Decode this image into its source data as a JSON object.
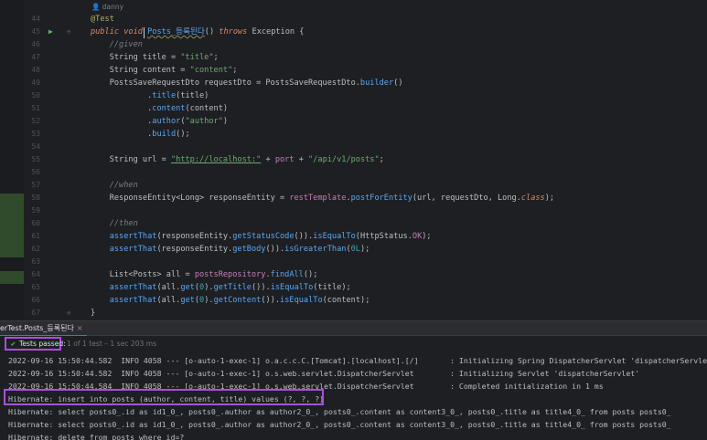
{
  "editor": {
    "author_hint": "👤 danny",
    "lines": [
      {
        "n": "44",
        "segs": [
          {
            "t": "@Test",
            "c": "ann"
          }
        ]
      },
      {
        "n": "45",
        "segs": [
          {
            "t": "public ",
            "c": "kw"
          },
          {
            "t": "void ",
            "c": "kw"
          },
          {
            "t": "Posts_등록된다",
            "c": "fn"
          },
          {
            "t": "() "
          },
          {
            "t": "throws ",
            "c": "kw"
          },
          {
            "t": "Exception {"
          }
        ]
      },
      {
        "n": "46",
        "segs": [
          {
            "t": "    //given",
            "c": "cm"
          }
        ]
      },
      {
        "n": "47",
        "segs": [
          {
            "t": "    String title = "
          },
          {
            "t": "\"title\"",
            "c": "str"
          },
          {
            "t": ";"
          }
        ]
      },
      {
        "n": "48",
        "segs": [
          {
            "t": "    String content = "
          },
          {
            "t": "\"content\"",
            "c": "str"
          },
          {
            "t": ";"
          }
        ]
      },
      {
        "n": "49",
        "segs": [
          {
            "t": "    PostsSaveRequestDto requestDto = PostsSaveRequestDto."
          },
          {
            "t": "builder",
            "c": "mth"
          },
          {
            "t": "()"
          }
        ]
      },
      {
        "n": "50",
        "segs": [
          {
            "t": "            ."
          },
          {
            "t": "title",
            "c": "mth"
          },
          {
            "t": "(title)"
          }
        ]
      },
      {
        "n": "51",
        "segs": [
          {
            "t": "            ."
          },
          {
            "t": "content",
            "c": "mth"
          },
          {
            "t": "(content)"
          }
        ]
      },
      {
        "n": "52",
        "segs": [
          {
            "t": "            ."
          },
          {
            "t": "author",
            "c": "mth"
          },
          {
            "t": "("
          },
          {
            "t": "\"author\"",
            "c": "str"
          },
          {
            "t": ")"
          }
        ]
      },
      {
        "n": "53",
        "segs": [
          {
            "t": "            ."
          },
          {
            "t": "build",
            "c": "mth"
          },
          {
            "t": "();"
          }
        ]
      },
      {
        "n": "54",
        "segs": []
      },
      {
        "n": "55",
        "segs": [
          {
            "t": "    String url = "
          },
          {
            "t": "\"http://localhost:\"",
            "c": "url"
          },
          {
            "t": " + "
          },
          {
            "t": "port",
            "c": "fld"
          },
          {
            "t": " + "
          },
          {
            "t": "\"/api/v1/posts\"",
            "c": "str"
          },
          {
            "t": ";"
          }
        ]
      },
      {
        "n": "56",
        "segs": []
      },
      {
        "n": "57",
        "segs": [
          {
            "t": "    //when",
            "c": "cm"
          }
        ]
      },
      {
        "n": "58",
        "segs": [
          {
            "t": "    ResponseEntity<Long> responseEntity = "
          },
          {
            "t": "restTemplate",
            "c": "fld"
          },
          {
            "t": "."
          },
          {
            "t": "postForEntity",
            "c": "mth"
          },
          {
            "t": "(url, requestDto, Long."
          },
          {
            "t": "class",
            "c": "kw"
          },
          {
            "t": ");"
          }
        ]
      },
      {
        "n": "59",
        "segs": []
      },
      {
        "n": "60",
        "segs": [
          {
            "t": "    //then",
            "c": "cm"
          }
        ]
      },
      {
        "n": "61",
        "segs": [
          {
            "t": "    "
          },
          {
            "t": "assertThat",
            "c": "mth"
          },
          {
            "t": "(responseEntity."
          },
          {
            "t": "getStatusCode",
            "c": "mth"
          },
          {
            "t": "())."
          },
          {
            "t": "isEqualTo",
            "c": "mth"
          },
          {
            "t": "(HttpStatus."
          },
          {
            "t": "OK",
            "c": "ok"
          },
          {
            "t": ");"
          }
        ]
      },
      {
        "n": "62",
        "segs": [
          {
            "t": "    "
          },
          {
            "t": "assertThat",
            "c": "mth"
          },
          {
            "t": "(responseEntity."
          },
          {
            "t": "getBody",
            "c": "mth"
          },
          {
            "t": "())."
          },
          {
            "t": "isGreaterThan",
            "c": "mth"
          },
          {
            "t": "("
          },
          {
            "t": "0L",
            "c": "num"
          },
          {
            "t": ");"
          }
        ]
      },
      {
        "n": "63",
        "segs": []
      },
      {
        "n": "64",
        "segs": [
          {
            "t": "    List<Posts> all = "
          },
          {
            "t": "postsRepository",
            "c": "fld"
          },
          {
            "t": "."
          },
          {
            "t": "findAll",
            "c": "mth"
          },
          {
            "t": "();"
          }
        ]
      },
      {
        "n": "65",
        "segs": [
          {
            "t": "    "
          },
          {
            "t": "assertThat",
            "c": "mth"
          },
          {
            "t": "(all."
          },
          {
            "t": "get",
            "c": "mth"
          },
          {
            "t": "("
          },
          {
            "t": "0",
            "c": "num"
          },
          {
            "t": ")."
          },
          {
            "t": "getTitle",
            "c": "mth"
          },
          {
            "t": "())."
          },
          {
            "t": "isEqualTo",
            "c": "mth"
          },
          {
            "t": "(title);"
          }
        ]
      },
      {
        "n": "66",
        "segs": [
          {
            "t": "    "
          },
          {
            "t": "assertThat",
            "c": "mth"
          },
          {
            "t": "(all."
          },
          {
            "t": "get",
            "c": "mth"
          },
          {
            "t": "("
          },
          {
            "t": "0",
            "c": "num"
          },
          {
            "t": ")."
          },
          {
            "t": "getContent",
            "c": "mth"
          },
          {
            "t": "())."
          },
          {
            "t": "isEqualTo",
            "c": "mth"
          },
          {
            "t": "(content);"
          }
        ]
      },
      {
        "n": "67",
        "segs": [
          {
            "t": "}"
          }
        ]
      },
      {
        "n": "68",
        "segs": []
      }
    ]
  },
  "run_panel": {
    "tab_label": "erTest.Posts_등록된다",
    "close_glyph": "×",
    "status_check": "✔",
    "status": "Tests passed:",
    "status_detail": "1 of 1 test – 1 sec 203 ms",
    "console_lines": [
      "2022-09-16 15:50:44.582  INFO 4058 --- [o-auto-1-exec-1] o.a.c.c.C.[Tomcat].[localhost].[/]       : Initializing Spring DispatcherServlet 'dispatcherServlet'",
      "2022-09-16 15:50:44.582  INFO 4058 --- [o-auto-1-exec-1] o.s.web.servlet.DispatcherServlet        : Initializing Servlet 'dispatcherServlet'",
      "2022-09-16 15:50:44.584  INFO 4058 --- [o-auto-1-exec-1] o.s.web.servlet.DispatcherServlet        : Completed initialization in 1 ms",
      "Hibernate: insert into posts (author, content, title) values (?, ?, ?)",
      "Hibernate: select posts0_.id as id1_0_, posts0_.author as author2_0_, posts0_.content as content3_0_, posts0_.title as title4_0_ from posts posts0_",
      "Hibernate: select posts0_.id as id1_0_, posts0_.author as author2_0_, posts0_.content as content3_0_, posts0_.title as title4_0_ from posts posts0_",
      "Hibernate: delete from posts where id=?"
    ]
  },
  "colors": {
    "highlight_box": "#a94fe0",
    "pass_green": "#5fb865",
    "editor_bg": "#1e1f22"
  }
}
